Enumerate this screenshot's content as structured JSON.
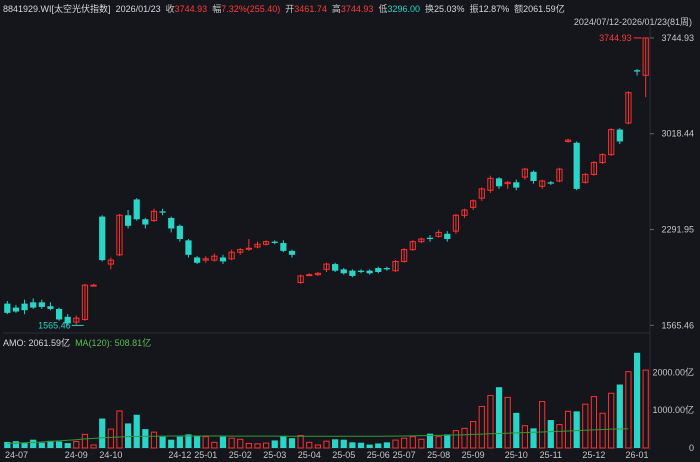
{
  "header": {
    "code": "8841929.WI[太空光伏指数]",
    "date": "2026/01/23",
    "close_label": "收",
    "close": "3744.93",
    "chg_label": "幅",
    "chg": "7.32%(255.40)",
    "open_label": "开",
    "open": "3461.74",
    "high_label": "高",
    "high": "3744.93",
    "low_label": "低",
    "low": "3296.00",
    "turn_label": "换",
    "turnover": "25.03%",
    "amp_label": "振",
    "amplitude": "12.87%",
    "amt_label": "额",
    "amount": "2061.59亿"
  },
  "range_label": "2024/07/12-2026/01/23(81周)",
  "volume_panel": {
    "amo_label": "AMO: 2061.59亿",
    "ma_label": "MA(120): 508.81亿"
  },
  "colors": {
    "up": "#ff3030",
    "down": "#2ad4c6",
    "ma": "#2f9a3a",
    "bg": "#14161b",
    "grid": "#2a2d33"
  },
  "chart_data": {
    "type": "candlestick",
    "price_axis_ticks": [
      1565.46,
      2291.95,
      3018.44,
      3744.93
    ],
    "volume_axis_ticks": [
      0,
      1000,
      2000
    ],
    "volume_axis_unit": "亿",
    "x_tick_labels": [
      "24-07",
      "24-09",
      "24-10",
      "24-12",
      "25-01",
      "25-02",
      "25-03",
      "25-04",
      "25-05",
      "25-06",
      "25-07",
      "25-08",
      "25-09",
      "25-10",
      "25-11",
      "25-12",
      "26-01"
    ],
    "x_tick_index": [
      0,
      8,
      12,
      20,
      23,
      27,
      31,
      35,
      39,
      43,
      46,
      50,
      54,
      59,
      63,
      68,
      73
    ],
    "max_annotation": "3744.93",
    "min_annotation": "1565.46",
    "ylim_price": [
      1530,
      3790
    ],
    "ylim_volume": [
      0,
      2700
    ],
    "candles": [
      {
        "o": 1730,
        "c": 1660,
        "h": 1750,
        "l": 1650,
        "v": 160
      },
      {
        "o": 1700,
        "c": 1670,
        "h": 1720,
        "l": 1660,
        "v": 180
      },
      {
        "o": 1730,
        "c": 1680,
        "h": 1760,
        "l": 1650,
        "v": 130
      },
      {
        "o": 1740,
        "c": 1700,
        "h": 1770,
        "l": 1690,
        "v": 220
      },
      {
        "o": 1740,
        "c": 1705,
        "h": 1760,
        "l": 1690,
        "v": 140
      },
      {
        "o": 1710,
        "c": 1690,
        "h": 1740,
        "l": 1680,
        "v": 190
      },
      {
        "o": 1690,
        "c": 1610,
        "h": 1700,
        "l": 1600,
        "v": 170
      },
      {
        "o": 1630,
        "c": 1580,
        "h": 1650,
        "l": 1565,
        "v": 130
      },
      {
        "o": 1590,
        "c": 1620,
        "h": 1640,
        "l": 1570,
        "v": 170
      },
      {
        "o": 1610,
        "c": 1870,
        "h": 1880,
        "l": 1600,
        "v": 360
      },
      {
        "o": 1870,
        "c": 1870,
        "h": 1880,
        "l": 1860,
        "v": 80
      },
      {
        "o": 2390,
        "c": 2060,
        "h": 2400,
        "l": 2050,
        "v": 780
      },
      {
        "o": 2030,
        "c": 2060,
        "h": 2080,
        "l": 1990,
        "v": 500
      },
      {
        "o": 2100,
        "c": 2400,
        "h": 2410,
        "l": 2090,
        "v": 980
      },
      {
        "o": 2400,
        "c": 2320,
        "h": 2440,
        "l": 2300,
        "v": 650
      },
      {
        "o": 2520,
        "c": 2370,
        "h": 2530,
        "l": 2360,
        "v": 880
      },
      {
        "o": 2370,
        "c": 2330,
        "h": 2380,
        "l": 2300,
        "v": 500
      },
      {
        "o": 2360,
        "c": 2430,
        "h": 2450,
        "l": 2350,
        "v": 420
      },
      {
        "o": 2430,
        "c": 2420,
        "h": 2450,
        "l": 2400,
        "v": 300
      },
      {
        "o": 2380,
        "c": 2300,
        "h": 2390,
        "l": 2270,
        "v": 220
      },
      {
        "o": 2320,
        "c": 2220,
        "h": 2330,
        "l": 2200,
        "v": 300
      },
      {
        "o": 2210,
        "c": 2100,
        "h": 2220,
        "l": 2080,
        "v": 360
      },
      {
        "o": 2080,
        "c": 2040,
        "h": 2090,
        "l": 2030,
        "v": 320
      },
      {
        "o": 2060,
        "c": 2070,
        "h": 2090,
        "l": 2040,
        "v": 300
      },
      {
        "o": 2060,
        "c": 2090,
        "h": 2110,
        "l": 2050,
        "v": 150
      },
      {
        "o": 2080,
        "c": 2050,
        "h": 2100,
        "l": 2030,
        "v": 300
      },
      {
        "o": 2070,
        "c": 2120,
        "h": 2140,
        "l": 2060,
        "v": 260
      },
      {
        "o": 2120,
        "c": 2140,
        "h": 2150,
        "l": 2100,
        "v": 230
      },
      {
        "o": 2150,
        "c": 2150,
        "h": 2220,
        "l": 2130,
        "v": 120
      },
      {
        "o": 2160,
        "c": 2180,
        "h": 2200,
        "l": 2150,
        "v": 110
      },
      {
        "o": 2180,
        "c": 2200,
        "h": 2210,
        "l": 2170,
        "v": 130
      },
      {
        "o": 2200,
        "c": 2190,
        "h": 2210,
        "l": 2180,
        "v": 200
      },
      {
        "o": 2190,
        "c": 2130,
        "h": 2210,
        "l": 2120,
        "v": 320
      },
      {
        "o": 2130,
        "c": 2100,
        "h": 2140,
        "l": 2080,
        "v": 260
      },
      {
        "o": 1890,
        "c": 1940,
        "h": 1950,
        "l": 1880,
        "v": 330
      },
      {
        "o": 1950,
        "c": 1950,
        "h": 1960,
        "l": 1940,
        "v": 150
      },
      {
        "o": 1950,
        "c": 1960,
        "h": 1970,
        "l": 1940,
        "v": 80
      },
      {
        "o": 1990,
        "c": 2030,
        "h": 2040,
        "l": 1970,
        "v": 180
      },
      {
        "o": 2030,
        "c": 1980,
        "h": 2040,
        "l": 1970,
        "v": 230
      },
      {
        "o": 1990,
        "c": 1960,
        "h": 2000,
        "l": 1950,
        "v": 220
      },
      {
        "o": 1980,
        "c": 1940,
        "h": 1990,
        "l": 1930,
        "v": 150
      },
      {
        "o": 1980,
        "c": 1970,
        "h": 1990,
        "l": 1960,
        "v": 140
      },
      {
        "o": 1980,
        "c": 1960,
        "h": 1990,
        "l": 1950,
        "v": 90
      },
      {
        "o": 2000,
        "c": 1970,
        "h": 2010,
        "l": 1960,
        "v": 120
      },
      {
        "o": 2000,
        "c": 1990,
        "h": 2010,
        "l": 1980,
        "v": 150
      },
      {
        "o": 1980,
        "c": 2050,
        "h": 2060,
        "l": 1970,
        "v": 210
      },
      {
        "o": 2050,
        "c": 2140,
        "h": 2150,
        "l": 2040,
        "v": 260
      },
      {
        "o": 2140,
        "c": 2200,
        "h": 2210,
        "l": 2130,
        "v": 300
      },
      {
        "o": 2200,
        "c": 2220,
        "h": 2230,
        "l": 2190,
        "v": 230
      },
      {
        "o": 2230,
        "c": 2220,
        "h": 2250,
        "l": 2200,
        "v": 380
      },
      {
        "o": 2240,
        "c": 2270,
        "h": 2290,
        "l": 2230,
        "v": 300
      },
      {
        "o": 2260,
        "c": 2220,
        "h": 2280,
        "l": 2200,
        "v": 360
      },
      {
        "o": 2280,
        "c": 2400,
        "h": 2410,
        "l": 2260,
        "v": 460
      },
      {
        "o": 2400,
        "c": 2440,
        "h": 2450,
        "l": 2380,
        "v": 520
      },
      {
        "o": 2460,
        "c": 2510,
        "h": 2520,
        "l": 2440,
        "v": 700
      },
      {
        "o": 2530,
        "c": 2600,
        "h": 2610,
        "l": 2510,
        "v": 1100
      },
      {
        "o": 2590,
        "c": 2680,
        "h": 2700,
        "l": 2570,
        "v": 1390
      },
      {
        "o": 2680,
        "c": 2620,
        "h": 2690,
        "l": 2600,
        "v": 1610
      },
      {
        "o": 2640,
        "c": 2650,
        "h": 2660,
        "l": 2600,
        "v": 1340
      },
      {
        "o": 2650,
        "c": 2610,
        "h": 2670,
        "l": 2590,
        "v": 930
      },
      {
        "o": 2690,
        "c": 2750,
        "h": 2760,
        "l": 2670,
        "v": 590
      },
      {
        "o": 2730,
        "c": 2660,
        "h": 2740,
        "l": 2640,
        "v": 520
      },
      {
        "o": 2620,
        "c": 2660,
        "h": 2670,
        "l": 2600,
        "v": 1230
      },
      {
        "o": 2650,
        "c": 2640,
        "h": 2660,
        "l": 2630,
        "v": 740
      },
      {
        "o": 2660,
        "c": 2750,
        "h": 2760,
        "l": 2650,
        "v": 620
      },
      {
        "o": 2960,
        "c": 2970,
        "h": 2980,
        "l": 2950,
        "v": 970
      },
      {
        "o": 2950,
        "c": 2600,
        "h": 2960,
        "l": 2590,
        "v": 970
      },
      {
        "o": 2650,
        "c": 2710,
        "h": 2720,
        "l": 2640,
        "v": 1160
      },
      {
        "o": 2710,
        "c": 2800,
        "h": 2810,
        "l": 2700,
        "v": 1360
      },
      {
        "o": 2800,
        "c": 2860,
        "h": 2870,
        "l": 2790,
        "v": 920
      },
      {
        "o": 2860,
        "c": 3050,
        "h": 3060,
        "l": 2850,
        "v": 1450
      },
      {
        "o": 3050,
        "c": 2960,
        "h": 3060,
        "l": 2940,
        "v": 1680
      },
      {
        "o": 3100,
        "c": 3330,
        "h": 3340,
        "l": 3090,
        "v": 2020
      },
      {
        "o": 3500,
        "c": 3490,
        "h": 3510,
        "l": 3460,
        "v": 2520
      },
      {
        "o": 3461.74,
        "c": 3744.93,
        "h": 3744.93,
        "l": 3296,
        "v": 2061.59
      }
    ],
    "ma120_values": [
      120,
      130,
      140,
      150,
      160,
      175,
      190,
      205,
      220,
      240,
      255,
      270,
      280,
      290,
      300,
      305,
      310,
      312,
      315,
      316,
      318,
      318,
      318,
      317,
      316,
      316,
      315,
      315,
      314,
      314,
      313,
      313,
      312,
      312,
      312,
      311,
      311,
      310,
      310,
      310,
      310,
      310,
      311,
      312,
      313,
      315,
      318,
      322,
      326,
      330,
      335,
      340,
      345,
      352,
      360,
      368,
      376,
      384,
      392,
      400,
      408,
      416,
      424,
      432,
      440,
      450,
      460,
      470,
      480,
      490,
      498,
      504,
      508.81
    ]
  }
}
